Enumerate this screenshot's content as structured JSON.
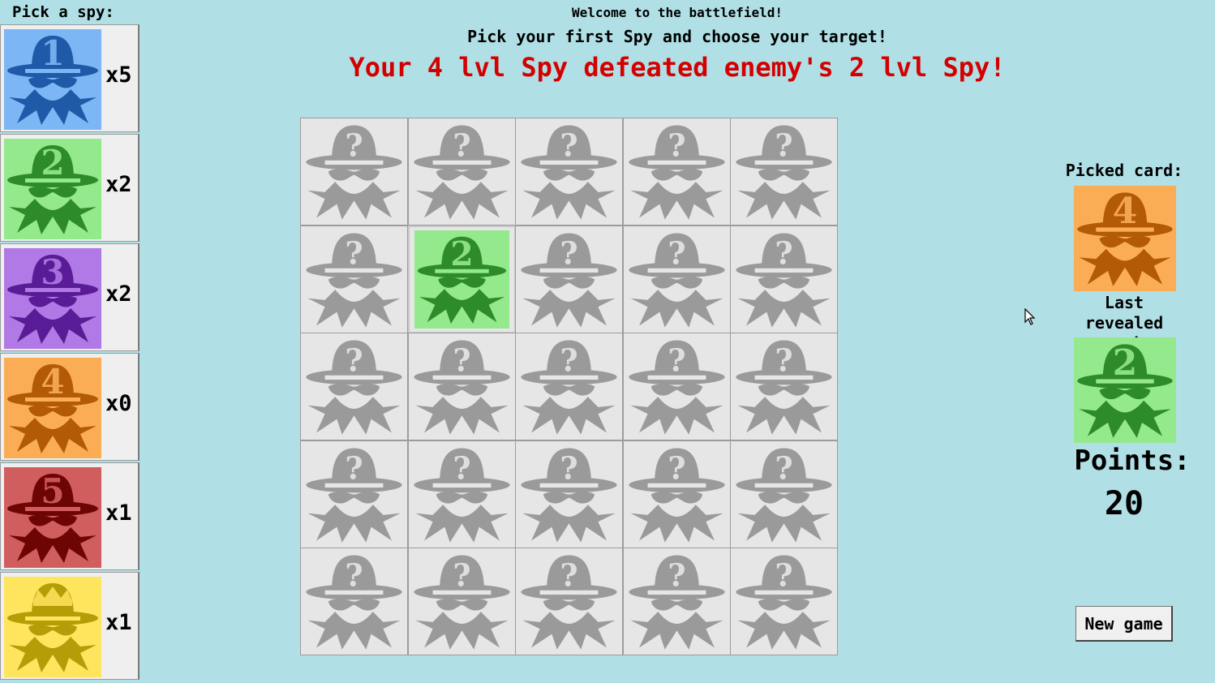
{
  "header": {
    "welcome": "Welcome to the battlefield!",
    "instruction": "Pick your first Spy and choose your target!",
    "message": "Your 4 lvl Spy defeated enemy's 2 lvl Spy!"
  },
  "sidebar": {
    "title": "Pick a spy:",
    "spies": [
      {
        "level": "1",
        "count": "x5",
        "bg": "#7db6f4",
        "fg": "#1e5aa8",
        "icon": "spy-level-1-icon"
      },
      {
        "level": "2",
        "count": "x2",
        "bg": "#93e98b",
        "fg": "#2e8b2a",
        "icon": "spy-level-2-icon"
      },
      {
        "level": "3",
        "count": "x2",
        "bg": "#b079e6",
        "fg": "#5a1c96",
        "icon": "spy-level-3-icon"
      },
      {
        "level": "4",
        "count": "x0",
        "bg": "#fbad56",
        "fg": "#b25a06",
        "icon": "spy-level-4-icon"
      },
      {
        "level": "5",
        "count": "x1",
        "bg": "#d15e5e",
        "fg": "#6e0505",
        "icon": "spy-level-5-icon"
      },
      {
        "level": "crown",
        "count": "x1",
        "bg": "#ffe45e",
        "fg": "#b49d07",
        "icon": "spy-king-icon"
      }
    ]
  },
  "board": {
    "rows": 5,
    "cols": 5,
    "hidden_bg": "#e6e6e6",
    "hidden_fg": "#9a9a9a",
    "revealed": [
      {
        "row": 2,
        "col": 2,
        "level": "2",
        "bg": "#93e98b",
        "fg": "#2e8b2a"
      }
    ]
  },
  "right_panel": {
    "picked_label": "Picked card:",
    "picked": {
      "level": "4",
      "bg": "#fbad56",
      "fg": "#b25a06"
    },
    "last_revealed_label": "Last revealed card:",
    "last_revealed": {
      "level": "2",
      "bg": "#93e98b",
      "fg": "#2e8b2a"
    },
    "points_label": "Points:",
    "points_value": "20",
    "new_game_label": "New game"
  },
  "colors": {
    "background": "#b0dfe5",
    "message": "#d40000"
  }
}
